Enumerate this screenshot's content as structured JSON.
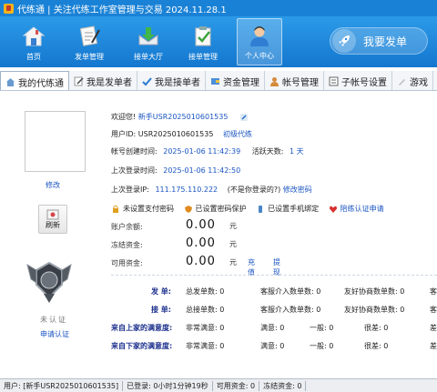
{
  "window": {
    "title": "代练通 | 关注代练工作室管理与交易 2024.11.28.1"
  },
  "toolbar": {
    "items": [
      {
        "label": "首页",
        "icon": "home-icon"
      },
      {
        "label": "发单管理",
        "icon": "publish-order-icon"
      },
      {
        "label": "接单大厅",
        "icon": "order-hall-icon"
      },
      {
        "label": "接单管理",
        "icon": "accept-order-icon"
      },
      {
        "label": "个人中心",
        "icon": "user-center-icon"
      }
    ],
    "publish_label": "我要发单"
  },
  "tabs": [
    {
      "label": "我的代练通"
    },
    {
      "label": "我是发单者"
    },
    {
      "label": "我是接单者"
    },
    {
      "label": "资金管理"
    },
    {
      "label": "帐号管理"
    },
    {
      "label": "子帐号设置"
    },
    {
      "label": "游戏"
    }
  ],
  "left": {
    "edit_label": "修改",
    "refresh_label": "刷新",
    "unverified_label": "未认证",
    "apply_verify_label": "申请认证"
  },
  "profile": {
    "welcome_prefix": "欢迎您!",
    "welcome_name": "新手USR2025010601535",
    "user_id_label": "用户ID:",
    "user_id": "USR2025010601535",
    "level": "初级代练",
    "created_label": "帐号创建时间:",
    "created_time": "2025-01-06 11:42:39",
    "active_days_label": "活跃天数:",
    "active_days": "1 天",
    "last_login_label": "上次登录时间:",
    "last_login_time": "2025-01-06 11:42:50",
    "last_ip_label": "上次登录IP:",
    "last_ip": "111.175.110.222",
    "not_me_label": "(不是你登录的?)",
    "change_password": "修改密码"
  },
  "security": [
    {
      "label": "未设置支付密码",
      "icon": "lock-icon"
    },
    {
      "label": "已设置密码保护",
      "icon": "shield-icon"
    },
    {
      "label": "已设置手机绑定",
      "icon": "phone-icon"
    },
    {
      "label": "陪练认证申请",
      "icon": "heart-icon"
    }
  ],
  "funds": {
    "balance_label": "账户余额:",
    "balance": "0.00",
    "frozen_label": "冻结资金:",
    "frozen": "0.00",
    "available_label": "可用资金:",
    "available": "0.00",
    "unit": "元",
    "recharge": "充值",
    "withdraw": "提现"
  },
  "stats": {
    "publish_label": "发  单:",
    "publish_total": "总发单数: 0",
    "publish_cs": "客服介入数单数: 0",
    "publish_friend": "友好协商数单数: 0",
    "accept_label": "接  单:",
    "accept_total": "总接单数: 0",
    "accept_cs": "客服介入数单数: 0",
    "accept_friend": "友好协商数单数: 0",
    "upstream_label": "来自上家的满意度:",
    "upstream_very": "非常满意: 0",
    "upstream_sat": "满意: 0",
    "upstream_normal": "一般: 0",
    "upstream_bad": "很差: 0",
    "downstream_label": "来自下家的满意度:",
    "downstream_very": "非常满意: 0",
    "downstream_sat": "满意: 0",
    "downstream_normal": "一般: 0",
    "downstream_bad": "很差: 0",
    "col5_top": "客",
    "col5_mid": "客",
    "col5_low1": "差",
    "col5_low2": "差"
  },
  "statusbar": {
    "user": "用户: [新手USR2025010601535]",
    "login": "已登录: 0小时1分钟19秒",
    "available": "可用资金: 0",
    "frozen": "冻结资金: 0"
  },
  "colors": {
    "titlebar": "#1a82d6",
    "toolbar": "#1a85da",
    "link": "#1a55c2",
    "stats_label": "#1b2f8c"
  }
}
